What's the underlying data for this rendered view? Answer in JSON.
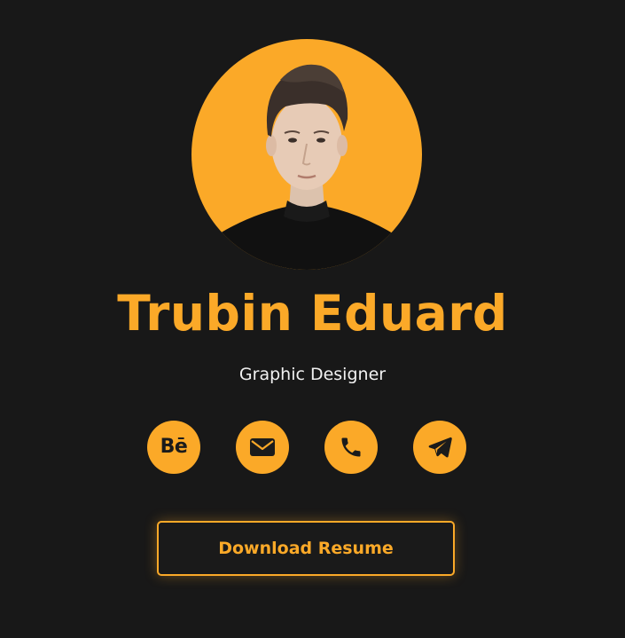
{
  "profile": {
    "name": "Trubin Eduard",
    "role": "Graphic Designer"
  },
  "socials": [
    {
      "id": "behance",
      "label": "Bē",
      "icon": "behance-icon"
    },
    {
      "id": "email",
      "label": "",
      "icon": "envelope-icon"
    },
    {
      "id": "phone",
      "label": "",
      "icon": "phone-icon"
    },
    {
      "id": "telegram",
      "label": "",
      "icon": "telegram-icon"
    }
  ],
  "cta": {
    "label": "Download Resume"
  },
  "colors": {
    "background": "#181818",
    "accent": "#fba928",
    "text": "#f1f1f1"
  }
}
